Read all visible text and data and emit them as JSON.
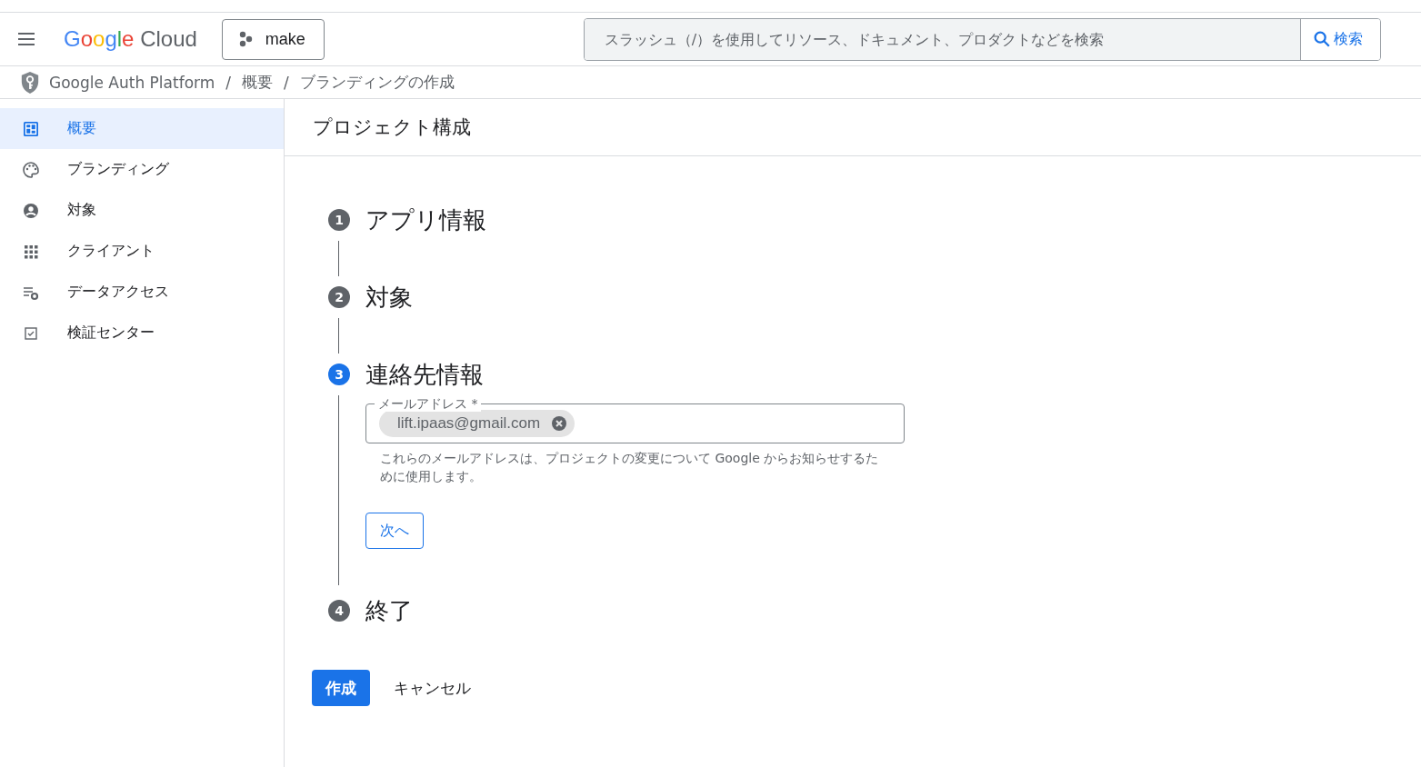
{
  "header": {
    "logo": {
      "brand": "Google",
      "product": "Cloud"
    },
    "project": "make",
    "search": {
      "placeholder": "スラッシュ（/）を使用してリソース、ドキュメント、プロダクトなどを検索",
      "button": "検索"
    }
  },
  "breadcrumb": [
    {
      "text": "Google Auth Platform"
    },
    {
      "separator": "/",
      "text": "概要"
    },
    {
      "separator": "/",
      "text": "ブランディングの作成"
    }
  ],
  "sidebar": {
    "items": [
      {
        "label": "概要",
        "selected": true
      },
      {
        "label": "ブランディング",
        "selected": false
      },
      {
        "label": "対象",
        "selected": false
      },
      {
        "label": "クライアント",
        "selected": false
      },
      {
        "label": "データアクセス",
        "selected": false
      },
      {
        "label": "検証センター",
        "selected": false
      }
    ]
  },
  "page_title": "プロジェクト構成",
  "steps": [
    {
      "number": "1",
      "title": "アプリ情報",
      "active": false
    },
    {
      "number": "2",
      "title": "対象",
      "active": false
    },
    {
      "number": "3",
      "title": "連絡先情報",
      "active": true
    },
    {
      "number": "4",
      "title": "終了",
      "active": false
    }
  ],
  "email_field": {
    "label": "メールアドレス *",
    "chip": "lift.ipaas@gmail.com",
    "helper": "これらのメールアドレスは、プロジェクトの変更について Google からお知らせするために使用します。"
  },
  "next_button": "次へ",
  "actions": {
    "create": "作成",
    "cancel": "キャンセル"
  }
}
